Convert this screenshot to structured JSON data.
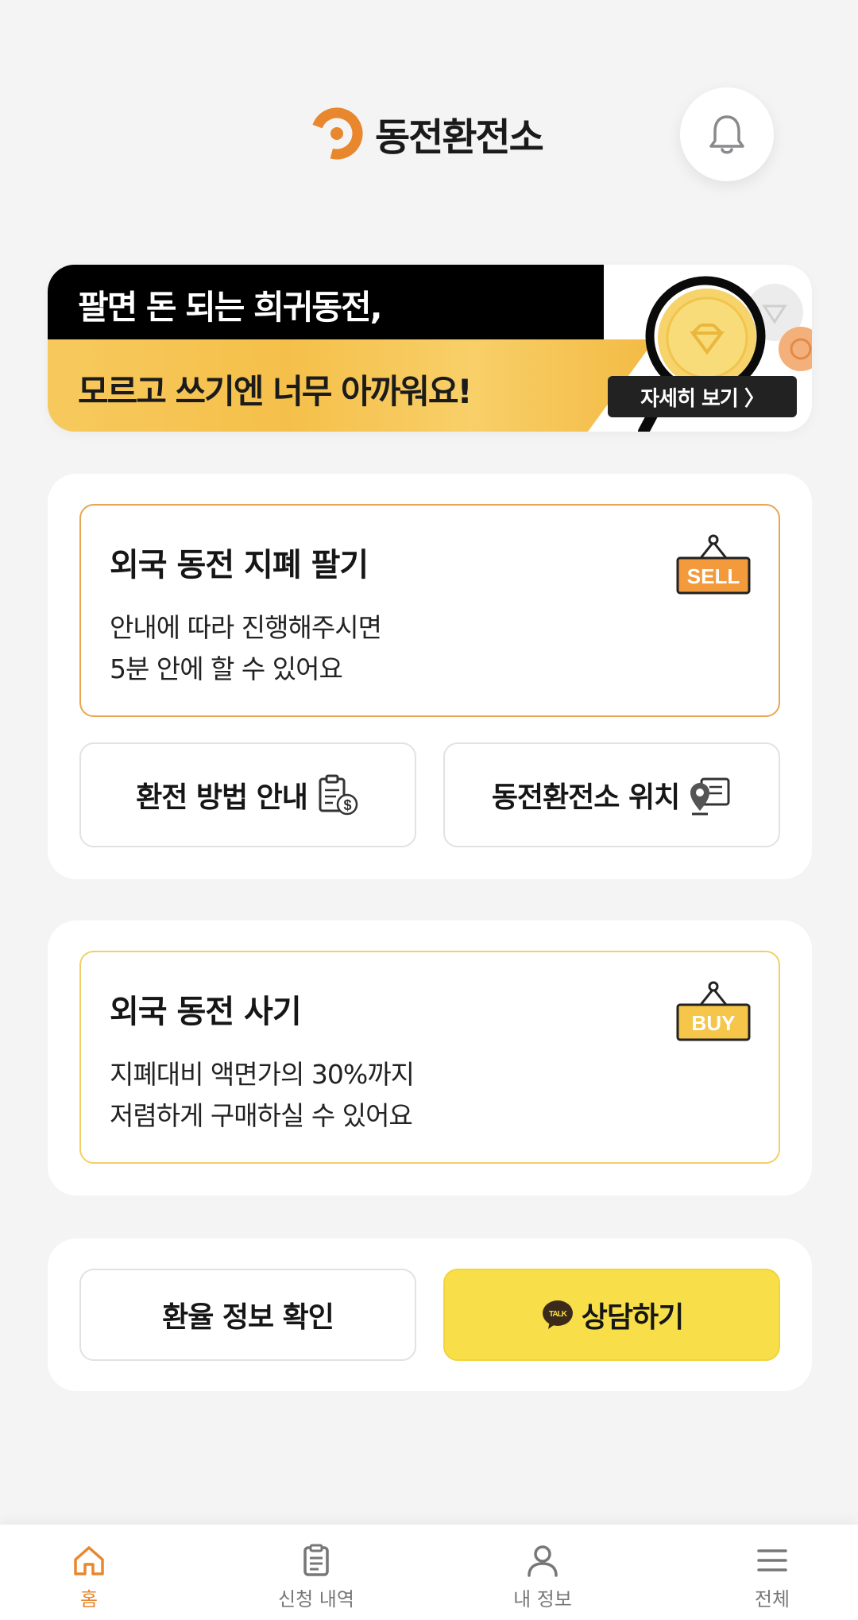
{
  "header": {
    "app_name": "동전환전소",
    "notification_icon": "bell-icon",
    "brand_color": "#e8872e"
  },
  "banner": {
    "line1": "팔면 돈 되는 희귀동전,",
    "line2": "모르고 쓰기엔 너무 아까워요!",
    "detail_button": "자세히 보기 〉"
  },
  "sell_card": {
    "title": "외국 동전 지폐 팔기",
    "desc_line1": "안내에 따라 진행해주시면",
    "desc_line2": "5분 안에 할 수 있어요",
    "sign_label": "SELL"
  },
  "guide_button": {
    "label": "환전 방법 안내",
    "icon": "clipboard-exchange-icon"
  },
  "location_button": {
    "label": "동전환전소 위치",
    "icon": "map-pin-icon"
  },
  "buy_card": {
    "title": "외국 동전 사기",
    "desc_line1": "지폐대비 액면가의 30%까지",
    "desc_line2": "저렴하게 구매하실 수 있어요",
    "sign_label": "BUY"
  },
  "rate_button": {
    "label": "환율 정보 확인"
  },
  "chat_button": {
    "label": "상담하기",
    "icon_text": "TALK"
  },
  "tabs": [
    {
      "label": "홈",
      "icon": "home-icon",
      "active": true
    },
    {
      "label": "신청 내역",
      "icon": "clipboard-icon",
      "active": false
    },
    {
      "label": "내 정보",
      "icon": "user-icon",
      "active": false
    },
    {
      "label": "전체",
      "icon": "menu-icon",
      "active": false
    }
  ],
  "colors": {
    "accent": "#e8872e",
    "kakao_yellow": "#f8df4a",
    "sell_border": "#e8a650",
    "buy_border": "#f0d066"
  }
}
